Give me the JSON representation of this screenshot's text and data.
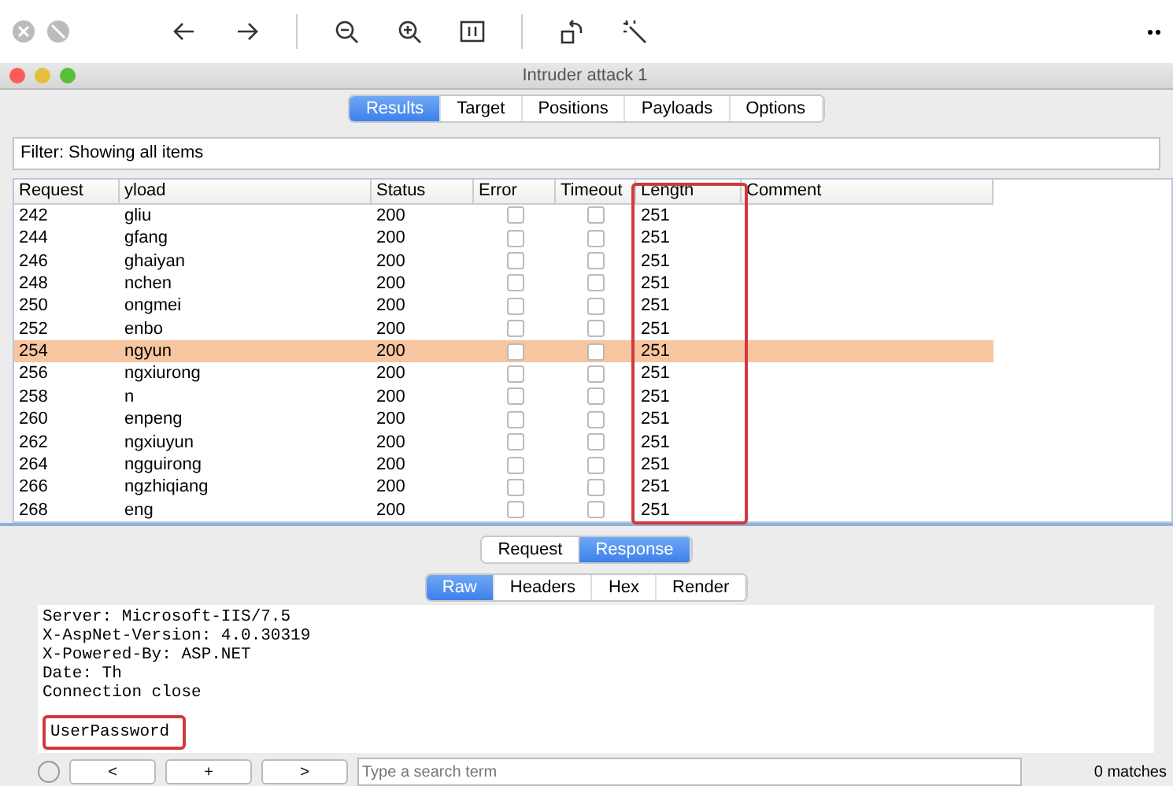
{
  "window": {
    "title": "Intruder attack 1"
  },
  "tabs": [
    {
      "label": "Results",
      "selected": true
    },
    {
      "label": "Target",
      "selected": false
    },
    {
      "label": "Positions",
      "selected": false
    },
    {
      "label": "Payloads",
      "selected": false
    },
    {
      "label": "Options",
      "selected": false
    }
  ],
  "filter": "Filter: Showing all items",
  "table": {
    "columns": [
      "Request",
      "yload",
      "Status",
      "Error",
      "Timeout",
      "Length",
      "Comment"
    ],
    "rows": [
      {
        "request": "242",
        "payload": "gliu",
        "status": "200",
        "error": false,
        "timeout": false,
        "length": "251",
        "selected": false
      },
      {
        "request": "244",
        "payload": "gfang",
        "status": "200",
        "error": false,
        "timeout": false,
        "length": "251",
        "selected": false
      },
      {
        "request": "246",
        "payload": "ghaiyan",
        "status": "200",
        "error": false,
        "timeout": false,
        "length": "251",
        "selected": false
      },
      {
        "request": "248",
        "payload": "nchen",
        "status": "200",
        "error": false,
        "timeout": false,
        "length": "251",
        "selected": false
      },
      {
        "request": "250",
        "payload": "ongmei",
        "status": "200",
        "error": false,
        "timeout": false,
        "length": "251",
        "selected": false
      },
      {
        "request": "252",
        "payload": "enbo",
        "status": "200",
        "error": false,
        "timeout": false,
        "length": "251",
        "selected": false
      },
      {
        "request": "254",
        "payload": "ngyun",
        "status": "200",
        "error": false,
        "timeout": false,
        "length": "251",
        "selected": true
      },
      {
        "request": "256",
        "payload": "ngxiurong",
        "status": "200",
        "error": false,
        "timeout": false,
        "length": "251",
        "selected": false
      },
      {
        "request": "258",
        "payload": "n",
        "status": "200",
        "error": false,
        "timeout": false,
        "length": "251",
        "selected": false
      },
      {
        "request": "260",
        "payload": "enpeng",
        "status": "200",
        "error": false,
        "timeout": false,
        "length": "251",
        "selected": false
      },
      {
        "request": "262",
        "payload": "ngxiuyun",
        "status": "200",
        "error": false,
        "timeout": false,
        "length": "251",
        "selected": false
      },
      {
        "request": "264",
        "payload": "ngguirong",
        "status": "200",
        "error": false,
        "timeout": false,
        "length": "251",
        "selected": false
      },
      {
        "request": "266",
        "payload": "ngzhiqiang",
        "status": "200",
        "error": false,
        "timeout": false,
        "length": "251",
        "selected": false
      },
      {
        "request": "268",
        "payload": "eng",
        "status": "200",
        "error": false,
        "timeout": false,
        "length": "251",
        "selected": false
      }
    ]
  },
  "message_tabs": [
    {
      "label": "Request",
      "selected": false
    },
    {
      "label": "Response",
      "selected": true
    }
  ],
  "view_tabs": [
    {
      "label": "Raw",
      "selected": true
    },
    {
      "label": "Headers",
      "selected": false
    },
    {
      "label": "Hex",
      "selected": false
    },
    {
      "label": "Render",
      "selected": false
    }
  ],
  "response_lines": [
    "Server: Microsoft-IIS/7.5",
    "X-AspNet-Version: 4.0.30319",
    "X-Powered-By: ASP.NET",
    "Date: Th",
    "Connection close"
  ],
  "response_body": "UserPassword",
  "nav_buttons": [
    "<",
    "+",
    ">"
  ],
  "search": {
    "placeholder": "Type a search term"
  },
  "matches": "0 matches"
}
